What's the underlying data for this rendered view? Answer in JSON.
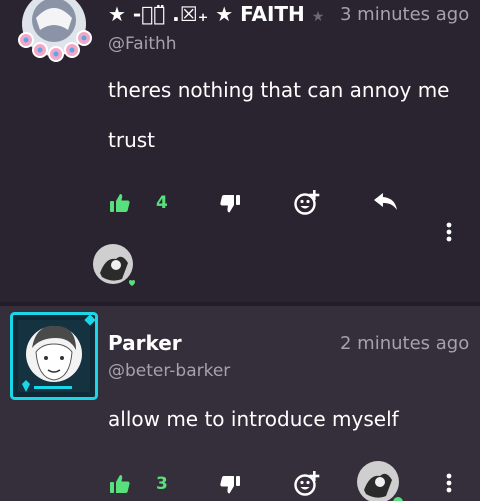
{
  "comments": [
    {
      "display_name": "★ -⃝⃝̈ .☒₊ ★ FAITH",
      "name_trail": "★",
      "time": "3 minutes ago",
      "handle": "@Faithh",
      "body_lines": [
        "theres nothing that can annoy me",
        "trust"
      ],
      "likes": "4",
      "has_reply_avatar": true
    },
    {
      "display_name": "Parker",
      "time": "2 minutes ago",
      "handle": "@beter-barker",
      "body_lines": [
        "allow me to introduce myself"
      ],
      "likes": "3",
      "has_reply_avatar": true
    }
  ],
  "colors": {
    "background": "#2a2430",
    "highlight_background": "#352f3b",
    "like_green": "#57e07b",
    "muted_text": "#a7a1ac",
    "frame_cyan": "#19d7e8"
  },
  "icons": {
    "like": "thumbs-up-icon",
    "dislike": "thumbs-down-icon",
    "react": "add-reaction-icon",
    "reply": "reply-arrow-icon",
    "more": "more-vertical-icon"
  }
}
